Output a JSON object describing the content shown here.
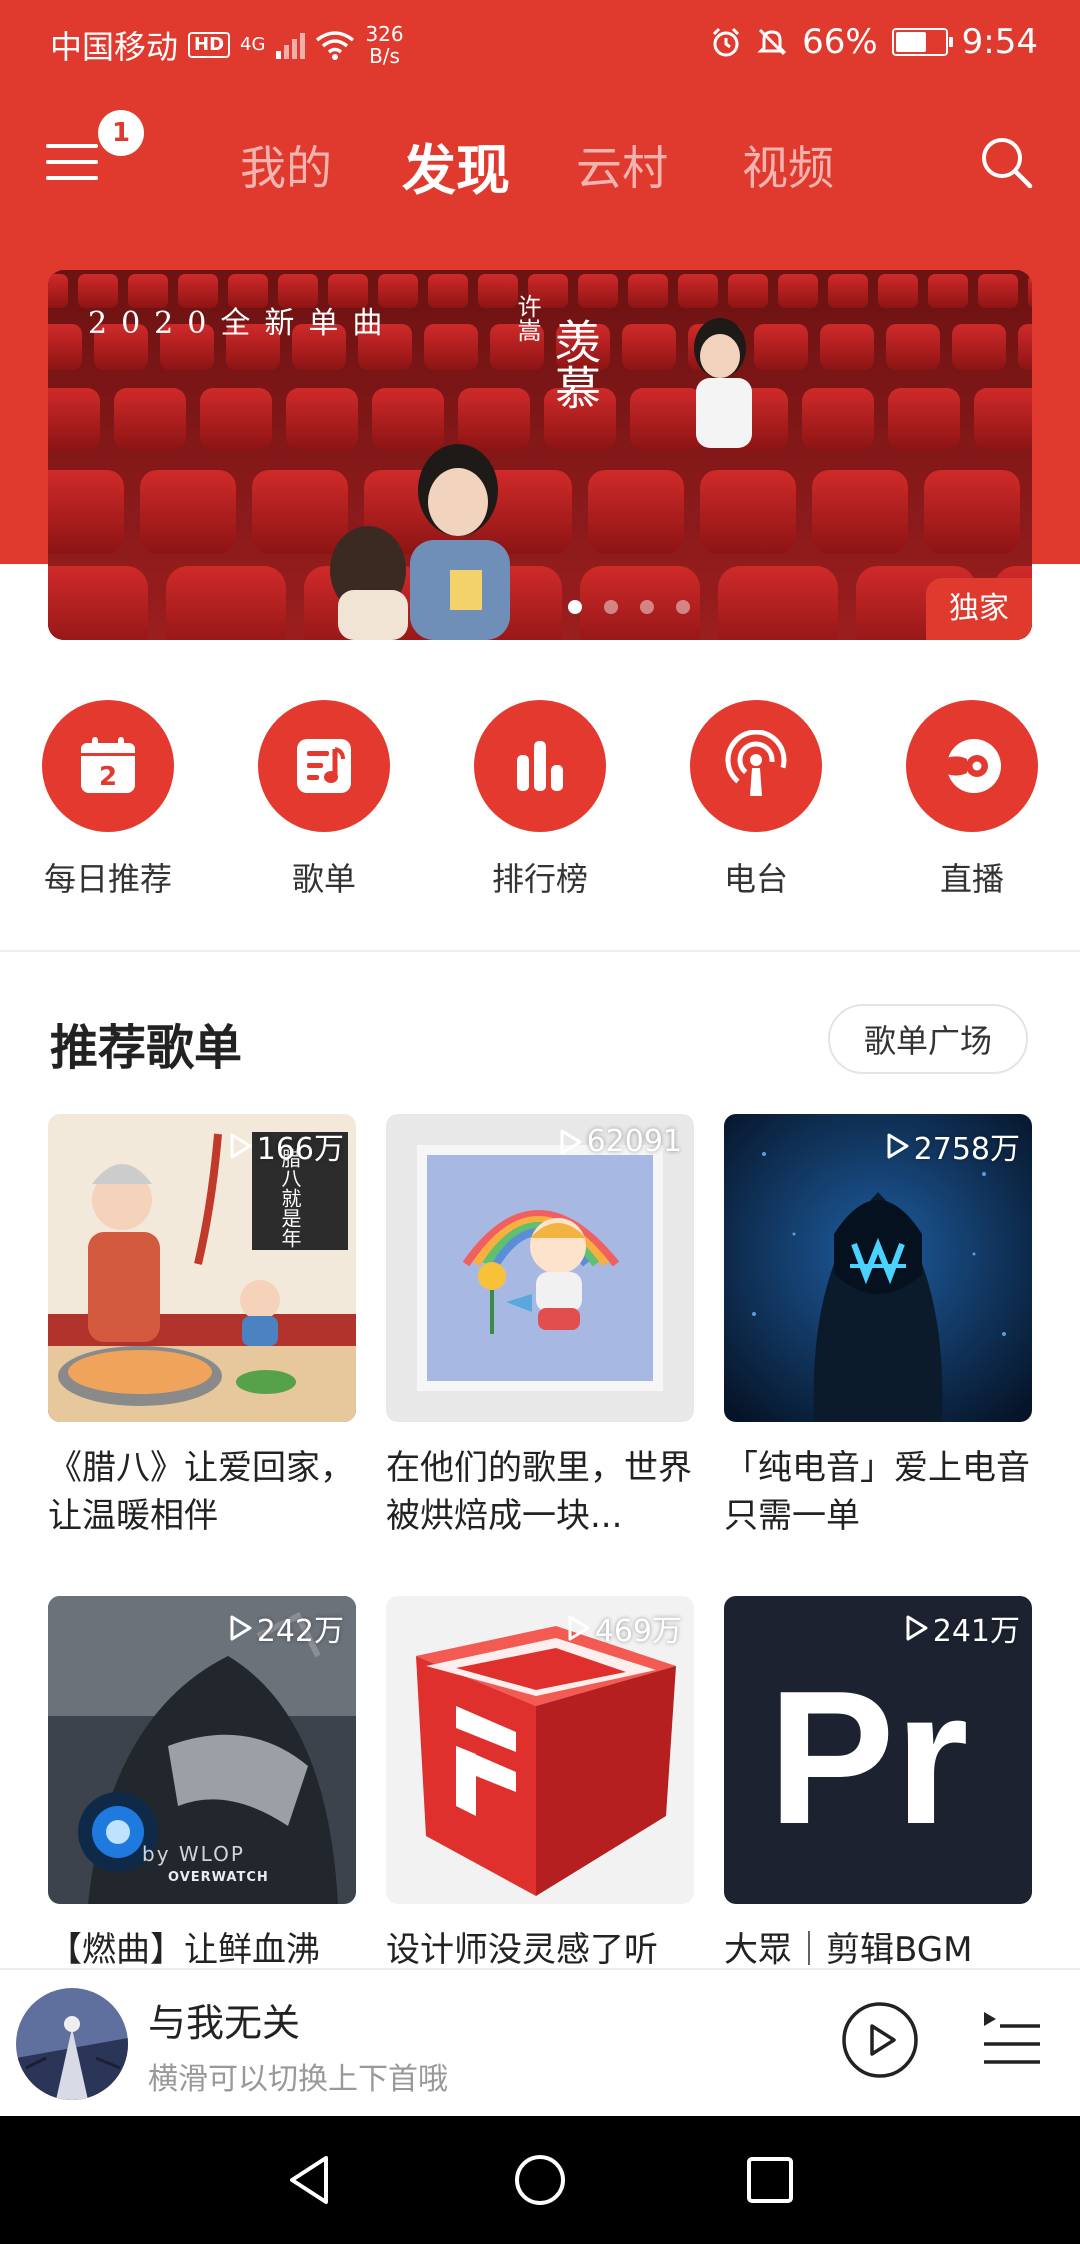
{
  "status_bar": {
    "carrier": "中国移动",
    "hd": "HD",
    "signal_type": "4G",
    "speed_value": "326",
    "speed_unit": "B/s",
    "battery": "66%",
    "battery_level": 0.66,
    "time": "9:54"
  },
  "header": {
    "menu_badge": "1",
    "tabs": [
      {
        "label": "我的"
      },
      {
        "label": "发现"
      },
      {
        "label": "云村"
      },
      {
        "label": "视频"
      }
    ],
    "active_tab": "发现"
  },
  "banner": {
    "top_text": "2020全新单曲",
    "artist_vertical": "许嵩",
    "song_vertical": "羡慕",
    "tag": "独家",
    "dots_total": 4,
    "active_dot": 0
  },
  "categories": [
    {
      "label": "每日推荐",
      "icon": "calendar-icon",
      "day": "2"
    },
    {
      "label": "歌单",
      "icon": "playlist-icon"
    },
    {
      "label": "排行榜",
      "icon": "chart-bars-icon"
    },
    {
      "label": "电台",
      "icon": "radio-icon"
    },
    {
      "label": "直播",
      "icon": "live-icon"
    }
  ],
  "section": {
    "title": "推荐歌单",
    "plaza_button": "歌单广场"
  },
  "playlists": [
    {
      "plays": "166万",
      "title": "《腊八》让爱回家，让温暖相伴"
    },
    {
      "plays": "62091",
      "title": "在他们的歌里，世界被烘焙成一块..."
    },
    {
      "plays": "2758万",
      "title": "「纯电音」爱上电音只需一单"
    },
    {
      "plays": "242万",
      "title": "【燃曲】让鲜血沸"
    },
    {
      "plays": "469万",
      "title": "设计师没灵感了听"
    },
    {
      "plays": "241万",
      "title": "大眾｜剪辑BGM"
    }
  ],
  "cover_texts": {
    "laba_sign": "腊八就是年",
    "overwatch_credit": "by WLOP",
    "overwatch_logo": "OVERWATCH",
    "premiere_logo": "Pr"
  },
  "player": {
    "song": "与我无关",
    "hint": "横滑可以切换上下首哦"
  },
  "colors": {
    "brand_red": "#e0392e",
    "text_dark": "#222222",
    "text_gray": "#999999"
  }
}
